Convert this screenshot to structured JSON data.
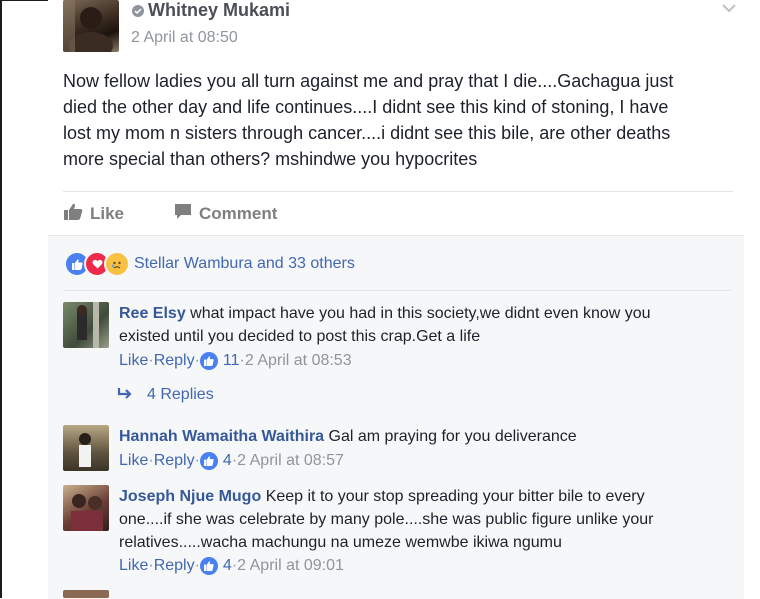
{
  "post": {
    "author": "Whitney Mukami",
    "time": "2 April at 08:50",
    "body_lines": [
      "Now fellow ladies you all turn against me and pray that I die....Gachagua just",
      "died the other day and life continues....I didnt see this kind of stoning, I have",
      "lost my mom n sisters through cancer....i didnt see this bile, are other deaths",
      "more special than others? mshindwe you hypocrites"
    ],
    "actions": {
      "like": "Like",
      "comment": "Comment"
    },
    "reactions_text": "Stellar Wambura and 33 others"
  },
  "comments": [
    {
      "author": "Ree Elsy",
      "text_lines": [
        "what impact have you had in this society,we didnt even know you",
        "existed until you decided to post this crap.Get a life"
      ],
      "like": "Like",
      "reply": "Reply",
      "likes": "11",
      "time": "2 April at 08:53",
      "replies": "4 Replies"
    },
    {
      "author": "Hannah Wamaitha Waithira",
      "text_lines": [
        "Gal am praying for you deliverance"
      ],
      "like": "Like",
      "reply": "Reply",
      "likes": "4",
      "time": "2 April at 08:57"
    },
    {
      "author": "Joseph Njue Mugo",
      "text_lines": [
        "Keep it to your stop spreading your bitter bile to every",
        "one....if she was celebrate by many pole....she was public figure unlike your",
        "relatives.....wacha machungu na umeze wemwbe ikiwa ngumu"
      ],
      "like": "Like",
      "reply": "Reply",
      "likes": "4",
      "time": "2 April at 09:01"
    }
  ],
  "separator": " · ",
  "colors": {
    "link": "#4267b2",
    "name": "#365899",
    "muted": "#90949c",
    "like_blue": "#4a80f0",
    "love_red": "#f0284a",
    "sad_yellow": "#f7c244"
  },
  "icons": {
    "verified": "verified-icon",
    "like_thumb": "thumbs-up-icon",
    "comment": "comment-bubble-icon",
    "reply_arrow": "reply-arrow-icon",
    "chevron": "chevron-down-icon"
  }
}
